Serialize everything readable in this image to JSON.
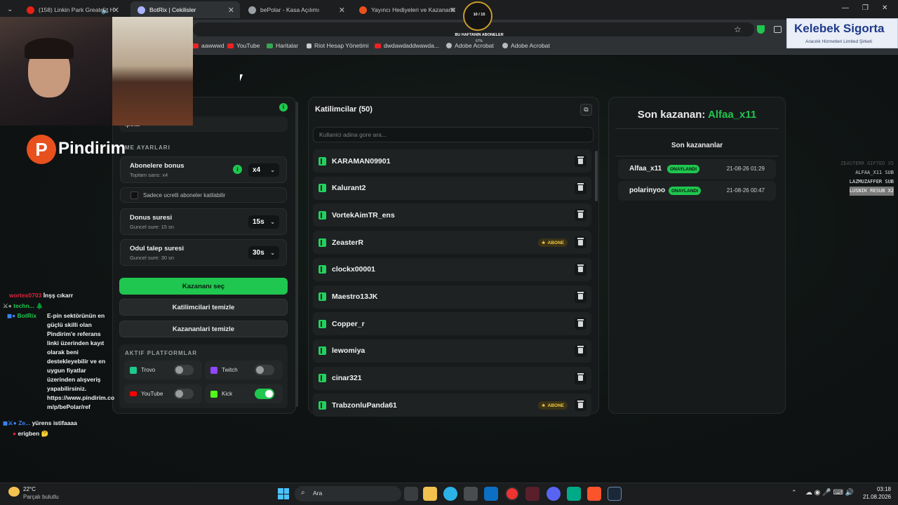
{
  "browser": {
    "tabs": [
      {
        "label": "(158) Linkin Park Greatest H",
        "color": "#e62117"
      },
      {
        "label": "BotRix | Cekilisler",
        "color": "#aab4ff"
      },
      {
        "label": "bePolar - Kasa Açılımı",
        "color": "#9aa0a6"
      },
      {
        "label": "Yayıncı Hediyeleri ve Kazananlar",
        "color": "#e8501e"
      }
    ],
    "new_tab": "+",
    "bookmarks": [
      "aawwwd",
      "YouTube",
      "Haritalar",
      "Riot Hesap Yönetimi",
      "dwdawdaddwawda...",
      "Adobe Acrobat",
      "Adobe Acrobat"
    ]
  },
  "overlays": {
    "sub_goal": {
      "count": "10 / 15",
      "label": "BU HAFTANIN ABONELER",
      "pct": "67%"
    },
    "sponsor": {
      "name": "Kelebek Sigorta",
      "sub": "Aracılık Hizmetleri Limited Şirketi"
    },
    "pindirim": "Pindirim",
    "events": [
      "ZEASTERR GIFTED X5",
      "ALFAA_X11 SUB",
      "LAZMUZAFFER SUB",
      "LUSNIK RESUB X2"
    ]
  },
  "settings": {
    "input_value": ":polar",
    "section_title": "ME AYARLARI",
    "sub_bonus": {
      "title": "Abonelere bonus",
      "sub": "Toplam sans: x4",
      "value": "x4"
    },
    "paid_only": "Sadece ucretli aboneler katilabilir",
    "donus": {
      "title": "Donus suresi",
      "sub": "Guncel sure: 15 sn",
      "value": "15s"
    },
    "odul": {
      "title": "Odul talep suresi",
      "sub": "Guncel sure: 30 sn",
      "value": "30s"
    },
    "pick_winner": "Kazananı seç",
    "clear_participants": "Katilimcilari temizle",
    "clear_winners": "Kazananlari temizle",
    "platforms_title": "AKTIF PLATFORMLAR",
    "platforms": [
      {
        "name": "Trovo",
        "on": false,
        "color": "#1ec98b"
      },
      {
        "name": "Twitch",
        "on": false,
        "color": "#9146ff"
      },
      {
        "name": "YouTube",
        "on": false,
        "color": "#ff0000"
      },
      {
        "name": "Kick",
        "on": true,
        "color": "#53fc18"
      }
    ]
  },
  "participants": {
    "title": "Katilimcilar (50)",
    "search_placeholder": "Kullanici adina gore ara...",
    "badge_label": "ABONE",
    "rows": [
      {
        "name": "KARAMAN09901",
        "abone": false
      },
      {
        "name": "Kalurant2",
        "abone": false
      },
      {
        "name": "VortekAimTR_ens",
        "abone": false
      },
      {
        "name": "ZeasterR",
        "abone": true
      },
      {
        "name": "clockx00001",
        "abone": false
      },
      {
        "name": "Maestro13JK",
        "abone": false
      },
      {
        "name": "Copper_r",
        "abone": false
      },
      {
        "name": "lewomiya",
        "abone": false
      },
      {
        "name": "cinar321",
        "abone": false
      },
      {
        "name": "TrabzonluPanda61",
        "abone": true
      }
    ]
  },
  "winners": {
    "last_label": "Son kazanan:",
    "last_name": "Alfaa_x11",
    "list_title": "Son kazananlar",
    "rows": [
      {
        "name": "Alfaa_x11",
        "status": "ONAYLANDI",
        "time": "21-08-26 01:29"
      },
      {
        "name": "polarinyoo",
        "status": "ONAYLANDI",
        "time": "21-08-26 00:47"
      }
    ]
  },
  "chat": [
    {
      "user": "wortex0703",
      "color": "#d9263c",
      "msg": "İnşş cıkarr"
    },
    {
      "user": "techn...",
      "color": "#1fc64f",
      "msg": "🌲"
    },
    {
      "user": "BotRix",
      "color": "#1fc64f",
      "msg": "E-pin sektörünün en güçlü skilli olan Pindirim'e referans linki üzerinden kayıt olarak beni destekleyebilir ve en uygun fiyatlar üzerinden alışveriş yapabilirsiniz. https://www.pindirim.com/p/bePolar/ref"
    },
    {
      "user": "Ze...",
      "color": "#3b82f6",
      "msg": "yürens istifaaaa"
    },
    {
      "user": "erigben",
      "color": "#e8e8e8",
      "msg": "🤔"
    }
  ],
  "taskbar": {
    "weather_temp": "22°C",
    "weather_desc": "Parçalı bulutlu",
    "search": "Ara",
    "time": "03:18",
    "date": "21.08.2026"
  }
}
